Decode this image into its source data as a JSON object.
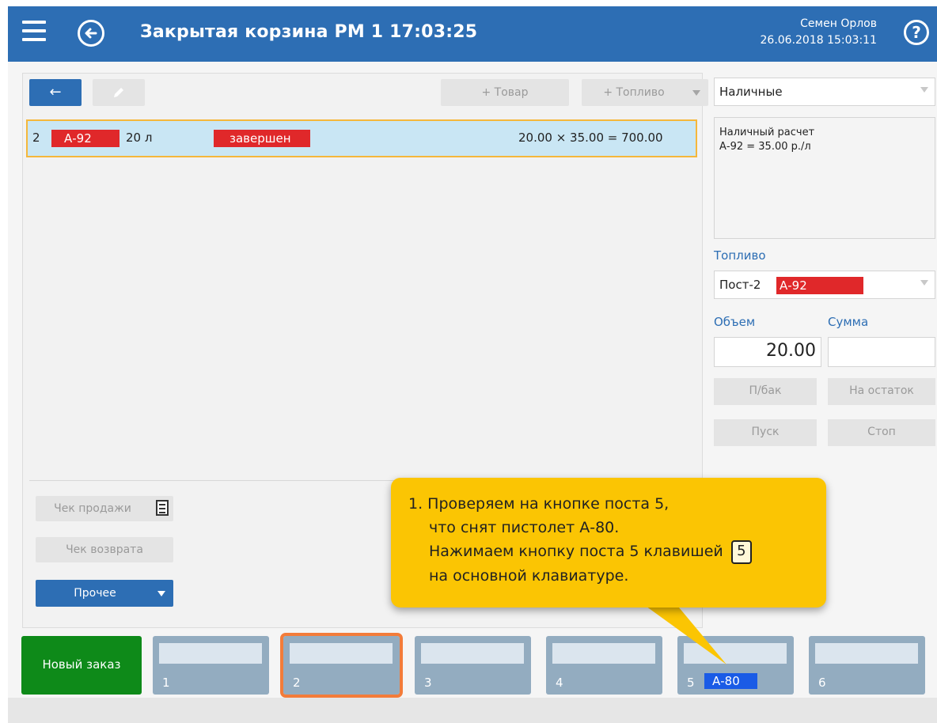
{
  "header": {
    "title": "Закрытая корзина  РМ 1  17:03:25",
    "user_name": "Семен Орлов",
    "datetime": "26.06.2018 15:03:11",
    "help_symbol": "?"
  },
  "toolbar": {
    "back_symbol": "←",
    "add_product_label": "+ Товар",
    "add_fuel_label": "+ Топливо"
  },
  "order": {
    "rows": [
      {
        "number": "2",
        "fuel": "А-92",
        "volume": "20 л",
        "status": "завершен",
        "calculation": "20.00 × 35.00 =  700.00"
      }
    ]
  },
  "left_actions": {
    "sale_receipt_label": "Чек продажи",
    "return_receipt_label": "Чек возврата",
    "other_label": "Прочее"
  },
  "payment": {
    "selected": "Наличные",
    "info_line1": "Наличный расчет",
    "info_line2": "А-92 = 35.00 р./л"
  },
  "fuel_section": {
    "label": "Топливо",
    "post": "Пост-2",
    "fuel": "А-92",
    "volume_label": "Объем",
    "sum_label": "Сумма",
    "volume_value": "20.00",
    "sum_value": "",
    "full_tank_label": "П/бак",
    "remainder_label": "На остаток",
    "start_label": "Пуск",
    "stop_label": "Стоп"
  },
  "bottom_bar": {
    "new_order_label": "Новый заказ",
    "posts": [
      {
        "number": "1",
        "fuel": ""
      },
      {
        "number": "2",
        "fuel": ""
      },
      {
        "number": "3",
        "fuel": ""
      },
      {
        "number": "4",
        "fuel": ""
      },
      {
        "number": "5",
        "fuel": "А-80"
      },
      {
        "number": "6",
        "fuel": ""
      }
    ]
  },
  "tooltip": {
    "line1": "1. Проверяем на кнопке поста 5,",
    "line2": "что снят пистолет А-80.",
    "line3": "Нажимаем кнопку поста 5 клавишей",
    "key": "5",
    "line4": "на основной клавиатуре."
  },
  "colors": {
    "header_blue": "#2d6eb4",
    "fuel_red": "#e0282a",
    "selection_orange": "#f37c3a",
    "tooltip_yellow": "#fbc503",
    "new_order_green": "#0e8a19"
  }
}
